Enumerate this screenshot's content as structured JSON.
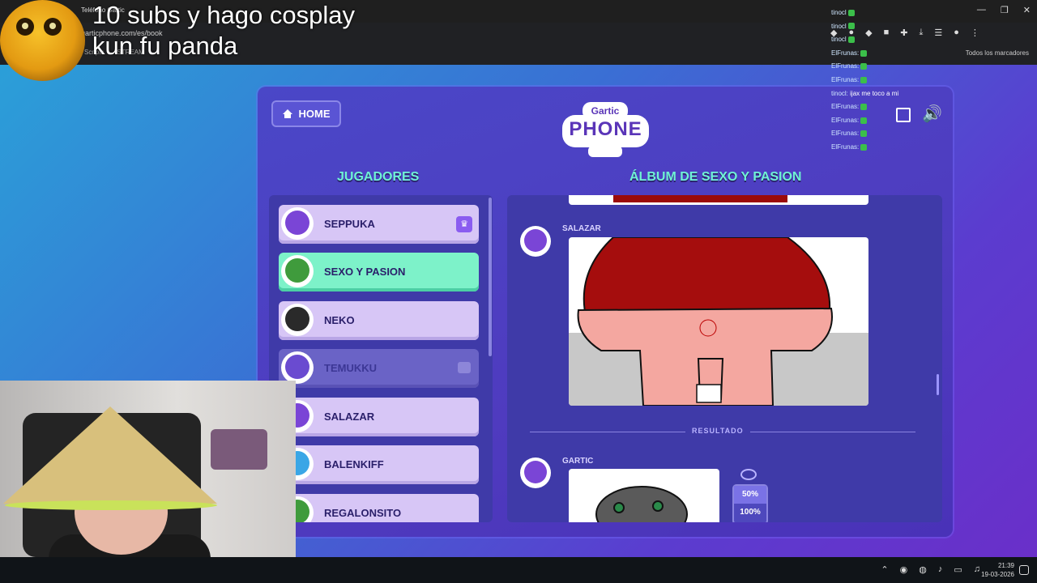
{
  "overlay": {
    "line1": "10 subs y hago cosplay",
    "line2": "kun fu panda"
  },
  "browser": {
    "tab_title": "Teléfono Gartic",
    "url": "garticphone.com/es/book",
    "bookmarks": [
      "Scripts",
      "STREAM"
    ],
    "bookmarks_right": "Todos los marcadores",
    "window_controls": [
      "—",
      "❐",
      "✕"
    ]
  },
  "game": {
    "home_label": "HOME",
    "logo_top": "Gartic",
    "logo_main": "PHONE",
    "players_heading": "JUGADORES",
    "album_heading": "ÁLBUM DE SEXO Y PASION",
    "players": [
      {
        "name": "SEPPUKA",
        "state": "host",
        "avatar_color": "#7a45d6"
      },
      {
        "name": "SEXO Y PASION",
        "state": "active",
        "avatar_color": "#3f9b3c"
      },
      {
        "name": "NEKO",
        "state": "normal",
        "avatar_color": "#2a2a2a"
      },
      {
        "name": "TEMUKKU",
        "state": "left",
        "avatar_color": "#6a4bd0"
      },
      {
        "name": "SALAZAR",
        "state": "normal",
        "avatar_color": "#7a45d6"
      },
      {
        "name": "BALENKIFF",
        "state": "normal",
        "avatar_color": "#3aa6e6"
      },
      {
        "name": "REGALONSITO",
        "state": "normal",
        "avatar_color": "#3f9b3c"
      }
    ],
    "album": {
      "entry1_author": "SALAZAR",
      "result_label": "RESULTADO",
      "entry2_author": "GARTIC",
      "zoom_options": [
        "50%",
        "100%"
      ],
      "zoom_selected": "50%"
    }
  },
  "chat": [
    {
      "user": "tinocl",
      "text": ""
    },
    {
      "user": "tinocl",
      "text": ""
    },
    {
      "user": "tinocl",
      "text": ""
    },
    {
      "user": "ElFrunas:",
      "text": ""
    },
    {
      "user": "ElFrunas:",
      "text": ""
    },
    {
      "user": "ElFrunas:",
      "text": ""
    },
    {
      "user": "tinocl:",
      "text": "ijax me toco a mi"
    },
    {
      "user": "ElFrunas:",
      "text": ""
    },
    {
      "user": "ElFrunas:",
      "text": ""
    },
    {
      "user": "ElFrunas:",
      "text": ""
    },
    {
      "user": "ElFrunas:",
      "text": ""
    }
  ],
  "taskbar": {
    "time": "21:39",
    "date": "19-03-2026"
  }
}
